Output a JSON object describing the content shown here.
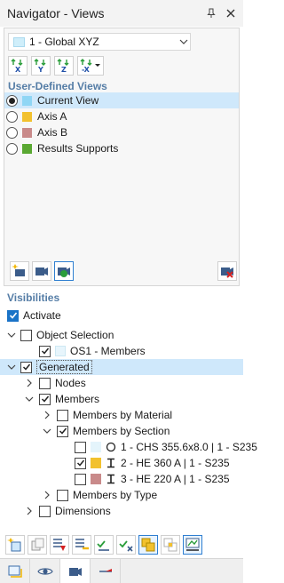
{
  "window": {
    "title": "Navigator - Views"
  },
  "view_selector": {
    "value": "1 - Global XYZ"
  },
  "user_defined_views": {
    "heading": "User-Defined Views",
    "items": [
      {
        "label": "Current View",
        "color": "#8fd6f5",
        "selected": true
      },
      {
        "label": "Axis A",
        "color": "#f2c12e",
        "selected": false
      },
      {
        "label": "Axis B",
        "color": "#c98a8a",
        "selected": false
      },
      {
        "label": "Results Supports",
        "color": "#5aa832",
        "selected": false
      }
    ]
  },
  "visibilities": {
    "heading": "Visibilities",
    "activate_label": "Activate",
    "tree": {
      "object_selection": "Object Selection",
      "os1_members": "OS1 - Members",
      "generated": "Generated",
      "nodes": "Nodes",
      "members": "Members",
      "members_by_material": "Members by Material",
      "members_by_section": "Members by Section",
      "section_1": "1 - CHS 355.6x8.0 | 1 - S235",
      "section_2": "2 - HE 360 A | 1 - S235",
      "section_3": "3 - HE 220 A | 1 - S235",
      "members_by_type": "Members by Type",
      "dimensions": "Dimensions"
    }
  },
  "colors": {
    "accent": "#1a73c7",
    "selection": "#cfe8fb",
    "section_heading": "#557da6",
    "section_2_swatch": "#f2c12e",
    "section_3_swatch": "#c98a8a"
  }
}
